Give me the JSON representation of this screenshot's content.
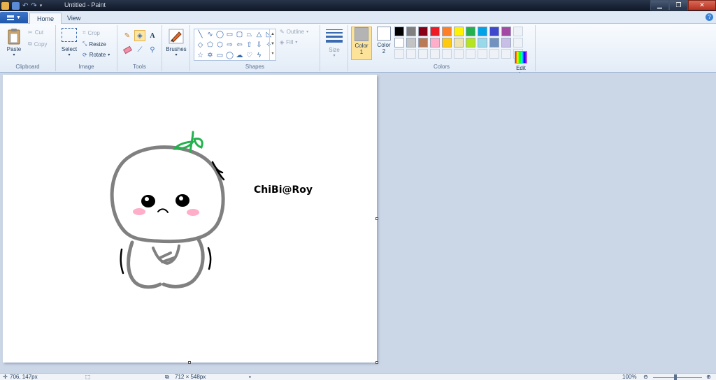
{
  "window": {
    "title": "Untitled - Paint"
  },
  "tabs": [
    {
      "label": "Home"
    },
    {
      "label": "View"
    }
  ],
  "clipboard": {
    "paste": "Paste",
    "cut": "Cut",
    "copy": "Copy",
    "group": "Clipboard"
  },
  "image": {
    "select": "Select",
    "crop": "Crop",
    "resize": "Resize",
    "rotate": "Rotate",
    "group": "Image"
  },
  "tools": {
    "group": "Tools"
  },
  "brushes": {
    "label": "Brushes"
  },
  "shapes": {
    "outline": "Outline",
    "fill": "Fill",
    "group": "Shapes"
  },
  "size": {
    "label": "Size"
  },
  "colors": {
    "color1_label": "Color",
    "color1_num": "1",
    "color2_label": "Color",
    "color2_num": "2",
    "edit": "Edit",
    "edit2": "colors",
    "group": "Colors",
    "color1_value": "#b4b4b4",
    "color2_value": "#ffffff",
    "row1": [
      "#000000",
      "#7f7f7f",
      "#880015",
      "#ed1c24",
      "#ff7f27",
      "#fff200",
      "#22b14c",
      "#00a2e8",
      "#3f48cc",
      "#a349a4"
    ],
    "row2": [
      "#ffffff",
      "#c3c3c3",
      "#b97a57",
      "#ffaec9",
      "#ffc90e",
      "#efe4b0",
      "#b5e61d",
      "#99d9ea",
      "#7092be",
      "#c8bfe7"
    ]
  },
  "canvas": {
    "signature": "ChiBi@Roy"
  },
  "status": {
    "cursor": "706, 147px",
    "size": "712 × 548px",
    "zoom": "100%"
  }
}
